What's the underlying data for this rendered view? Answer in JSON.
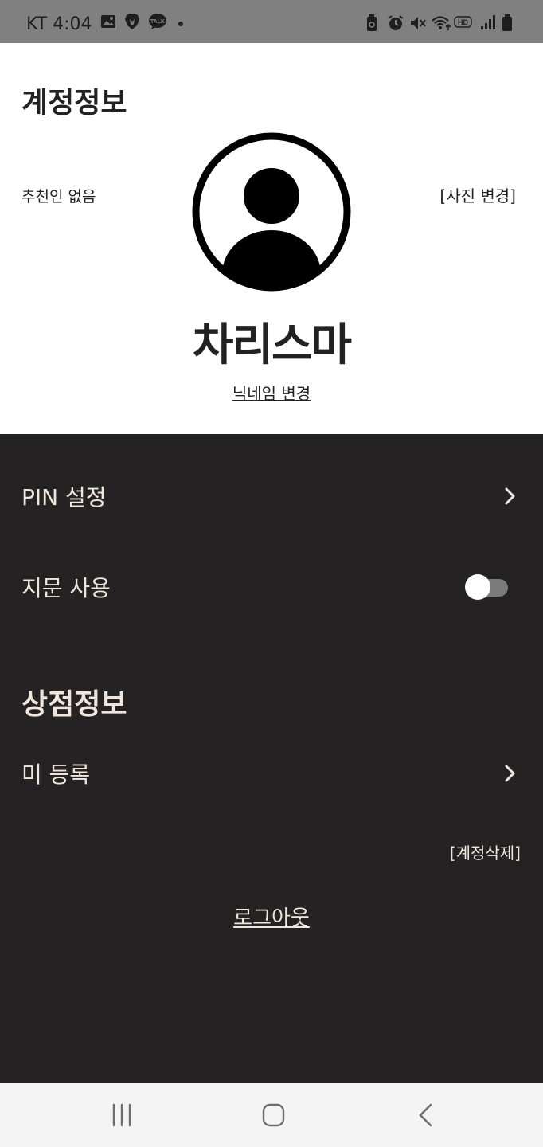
{
  "status_bar": {
    "carrier_time": "KT 4:04",
    "left_icons": [
      "gallery-icon",
      "brave-icon",
      "kakaotalk-icon",
      "dot-icon"
    ],
    "right_icons": [
      "battery-saver-icon",
      "alarm-icon",
      "mute-icon",
      "wifi-icon",
      "hd-icon",
      "signal-icon",
      "battery-icon"
    ],
    "hd_label": "HD"
  },
  "account": {
    "title": "계정정보",
    "referrer": "추천인 없음",
    "photo_change": "[사진 변경]",
    "nickname": "차리스마",
    "nickname_change": "닉네임 변경"
  },
  "settings": {
    "pin_label": "PIN 설정",
    "fingerprint_label": "지문 사용",
    "fingerprint_enabled": false,
    "store_title": "상점정보",
    "store_status": "미 등록",
    "delete_account": "[계정삭제]",
    "logout": "로그아웃"
  },
  "nav_bar": {
    "buttons": [
      "recent-apps-icon",
      "home-icon",
      "back-icon"
    ]
  },
  "colors": {
    "status_bar_bg": "#808080",
    "dark_bg": "#252223",
    "dark_text": "#f1e6dd",
    "toggle_track": "#7b7b7b",
    "nav_bg": "#f4f4f4"
  }
}
